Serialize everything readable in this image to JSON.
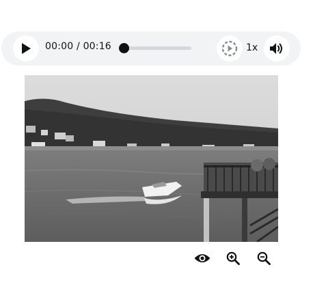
{
  "player": {
    "time_display": "00:00 / 00:16",
    "speed_label": "1x",
    "progress": 0.0,
    "icons": {
      "play": "play-icon",
      "speed": "playback-speed-icon",
      "volume": "volume-icon"
    }
  },
  "image": {
    "alt": "Grayscale photo of a motorboat on a lake beside a deck"
  },
  "toolbar": {
    "icons": [
      "eye-icon",
      "zoom-in-icon",
      "zoom-out-icon"
    ]
  },
  "colors": {
    "player_background": "#f1f3f4",
    "track": "#d6d8db",
    "icon": "#111111"
  }
}
